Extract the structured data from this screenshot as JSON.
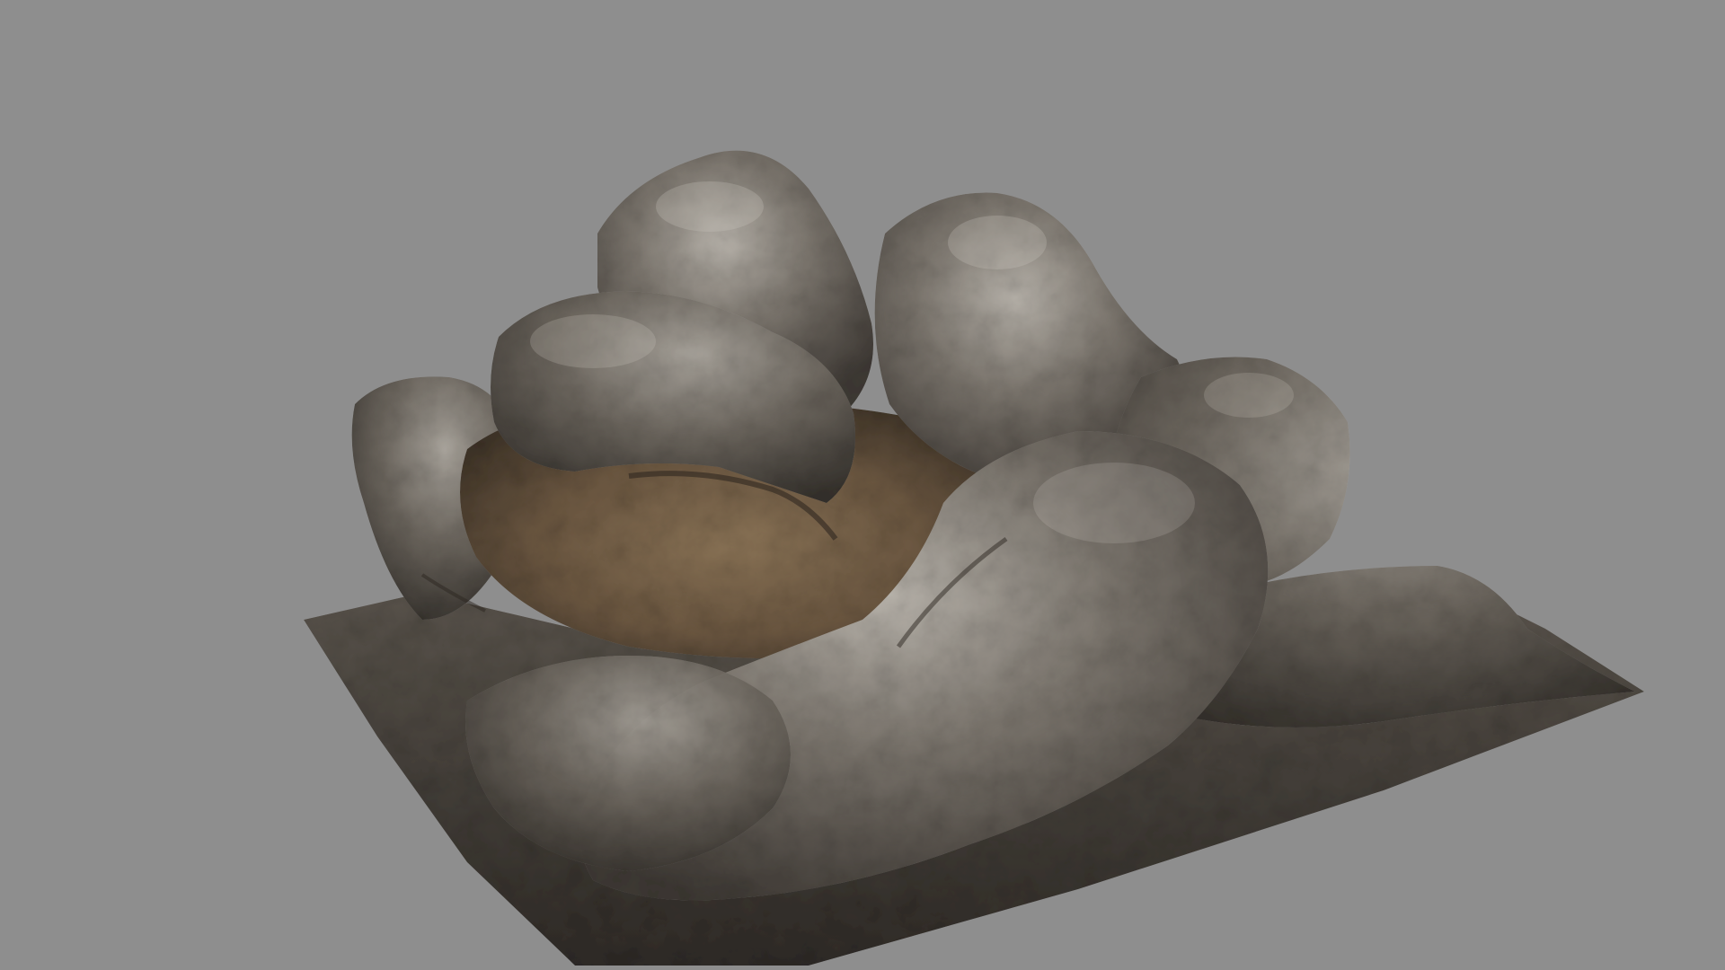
{
  "scene": {
    "background_color": "#8e8e8e",
    "subject": "rock-formation-model",
    "palette": {
      "rock_dark": "#3b3631",
      "rock_mid": "#6b655d",
      "rock_light": "#b7b2aa",
      "cavity_brown": "#6e5a43",
      "cavity_deep": "#4a3d2e",
      "ground": "#4a443d"
    }
  }
}
